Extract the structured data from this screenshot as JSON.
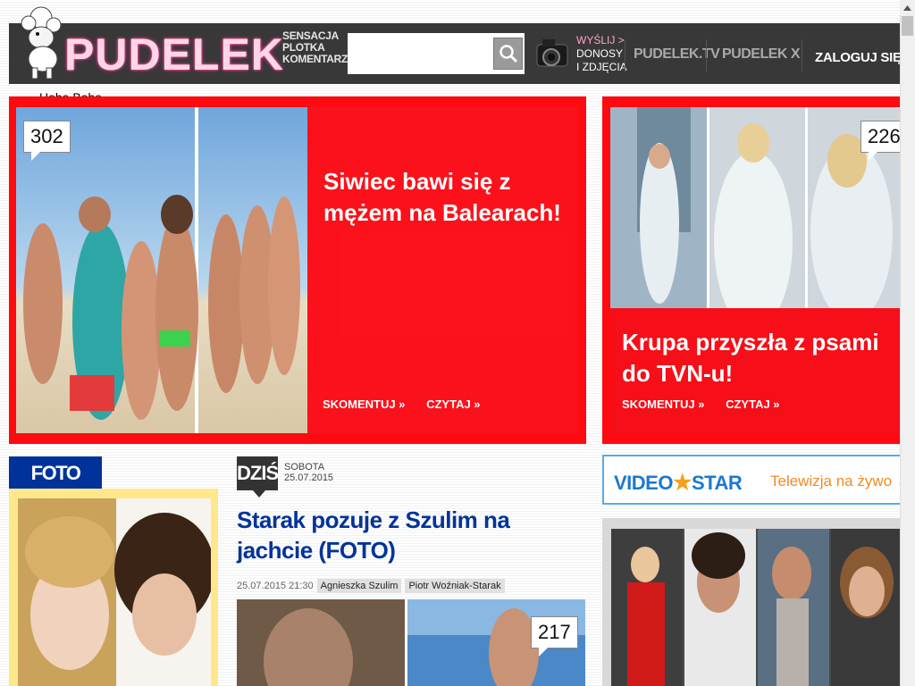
{
  "header": {
    "logo_text": "PUDELEK",
    "tagline": [
      "SENSACJA",
      "PLOTKA",
      "KOMENTARZ"
    ],
    "search_placeholder": "",
    "send_line1": "WYŚLIJ >",
    "send_line2": "DONOSY",
    "send_line3": "I ZDJĘCIA",
    "nav": {
      "tv": "PUDELEK.TV",
      "x": "PUDELEK X"
    },
    "login": "ZALOGUJ SIĘ",
    "login_arrow": "›"
  },
  "haba_baba": "Haba Baba",
  "hero_left": {
    "comments": "302",
    "title": "Siwiec bawi się z mężem na Balearach!",
    "comment_link": "SKOMENTUJ »",
    "read_link": "CZYTAJ »"
  },
  "hero_right": {
    "comments": "226",
    "title": "Krupa przyszła z psami do TVN-u!",
    "comment_link": "SKOMENTUJ »",
    "read_link": "CZYTAJ »"
  },
  "foto": {
    "label": "FOTO FOTO"
  },
  "today": {
    "label": "DZIŚ",
    "day": "SOBOTA",
    "date": "25.07.2015",
    "article_title": "Starak pozuje z Szulim na jachcie (FOTO)",
    "timestamp": "25.07.2015 21:30",
    "tags": [
      "Agnieszka Szulim",
      "Piotr Woźniak-Starak"
    ],
    "comments": "217"
  },
  "videostar": {
    "brand_left": "VIDEO",
    "brand_right": "STAR",
    "link": "Telewizja na żywo →"
  },
  "colors": {
    "accent_red": "#ff0a10",
    "brand_blue": "#003399",
    "header_bg": "#383838"
  }
}
